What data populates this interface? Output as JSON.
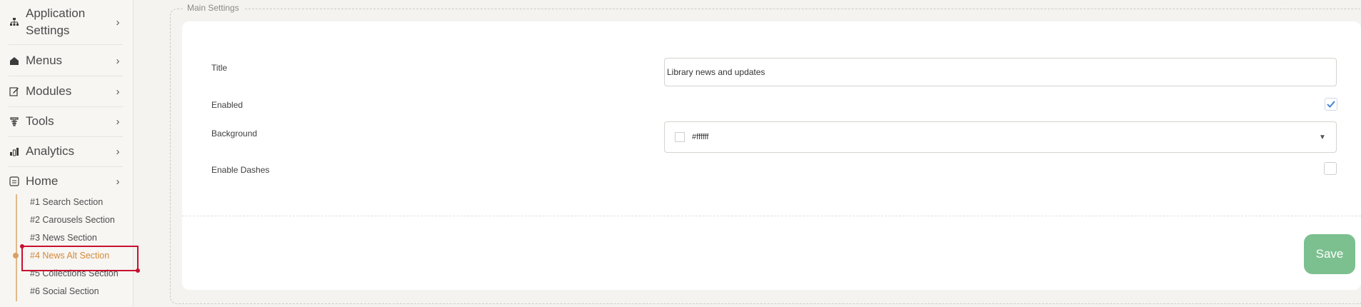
{
  "sidebar": {
    "items": [
      {
        "label_line1": "Application",
        "label_line2": "Settings",
        "icon": "sitemap-icon"
      },
      {
        "label": "Menus",
        "icon": "home-icon"
      },
      {
        "label": "Modules",
        "icon": "edit-icon"
      },
      {
        "label": "Tools",
        "icon": "tools-icon"
      },
      {
        "label": "Analytics",
        "icon": "chart-icon"
      },
      {
        "label": "Home",
        "icon": "home-page-icon"
      }
    ],
    "sub_items": [
      {
        "label": "#1 Search Section"
      },
      {
        "label": "#2 Carousels Section"
      },
      {
        "label": "#3 News Section"
      },
      {
        "label": "#4 News Alt Section",
        "active": true
      },
      {
        "label": "#5 Collections Section"
      },
      {
        "label": "#6 Social Section"
      }
    ]
  },
  "main": {
    "section_title": "Main Settings",
    "fields": {
      "title": {
        "label": "Title",
        "value": "Library news and updates"
      },
      "enabled": {
        "label": "Enabled",
        "checked": true
      },
      "background": {
        "label": "Background",
        "value": "#ffffff",
        "swatch_color": "#ffffff"
      },
      "enable_dashes": {
        "label": "Enable Dashes",
        "checked": false
      }
    },
    "save_label": "Save"
  },
  "colors": {
    "accent": "#d48a3b",
    "save_button": "#7cc08f",
    "highlight_box": "#c8102e",
    "check": "#3a7bd5"
  }
}
